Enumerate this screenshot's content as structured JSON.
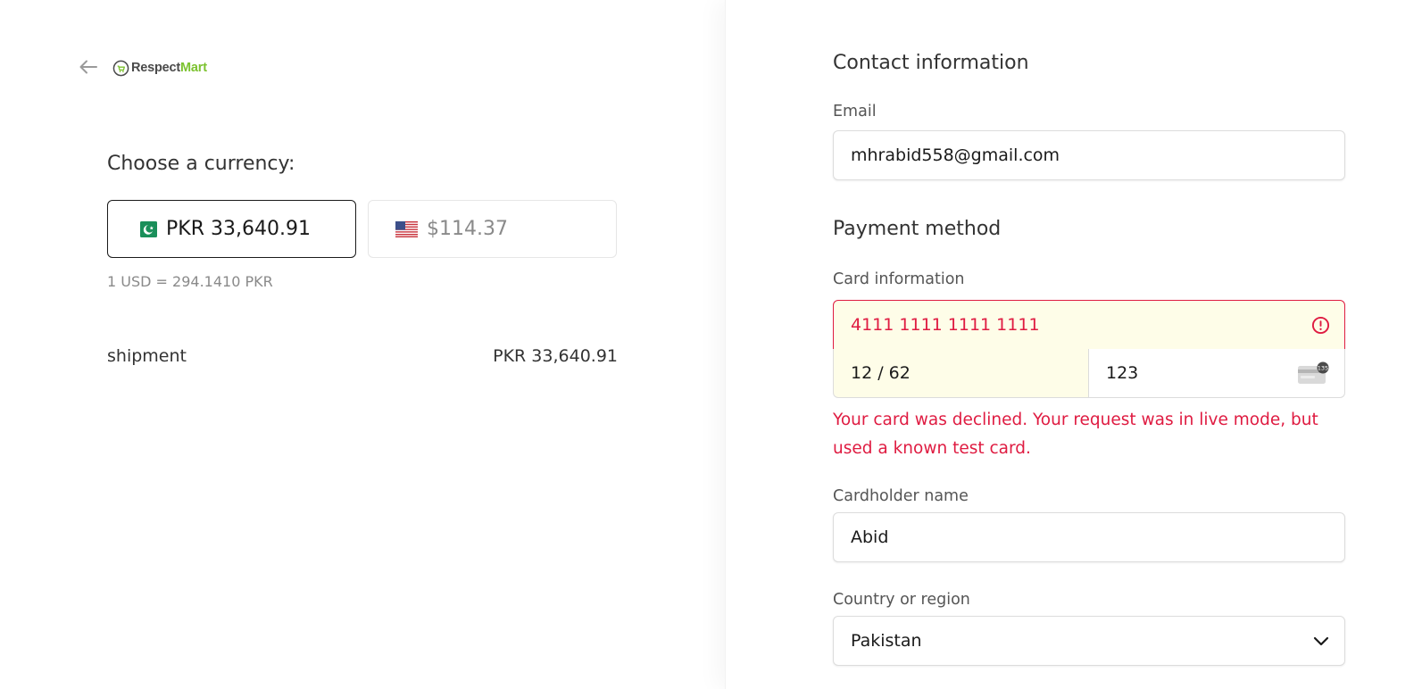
{
  "header": {
    "back_icon": "arrow-left-icon",
    "logo_word1": "Respect",
    "logo_word2": "Mart",
    "logo_colors": {
      "word1": "#4a4a4a",
      "word2": "#7cc22f"
    }
  },
  "currency": {
    "label": "Choose a currency:",
    "options": [
      {
        "flag": "pakistan-flag-icon",
        "amount": "PKR 33,640.91",
        "selected": true
      },
      {
        "flag": "us-flag-icon",
        "amount": "$114.37",
        "selected": false
      }
    ],
    "rate": "1 USD = 294.1410 PKR"
  },
  "summary": {
    "item_name": "shipment",
    "item_price": "PKR 33,640.91"
  },
  "contact": {
    "heading": "Contact information",
    "email_label": "Email",
    "email_value": "mhrabid558@gmail.com"
  },
  "payment": {
    "heading": "Payment method",
    "card_label": "Card information",
    "card_number": "4111 1111 1111 1111",
    "expiry": "12 / 62",
    "cvc": "123",
    "cvc_badge": "135",
    "error": "Your card was declined. Your request was in live mode, but used a known test card.",
    "cardholder_label": "Cardholder name",
    "cardholder_value": "Abid",
    "country_label": "Country or region",
    "country_value": "Pakistan"
  },
  "colors": {
    "error": "#df1b41",
    "autofill_bg": "#fefde8",
    "pakistan_green": "#1a8f5a"
  }
}
